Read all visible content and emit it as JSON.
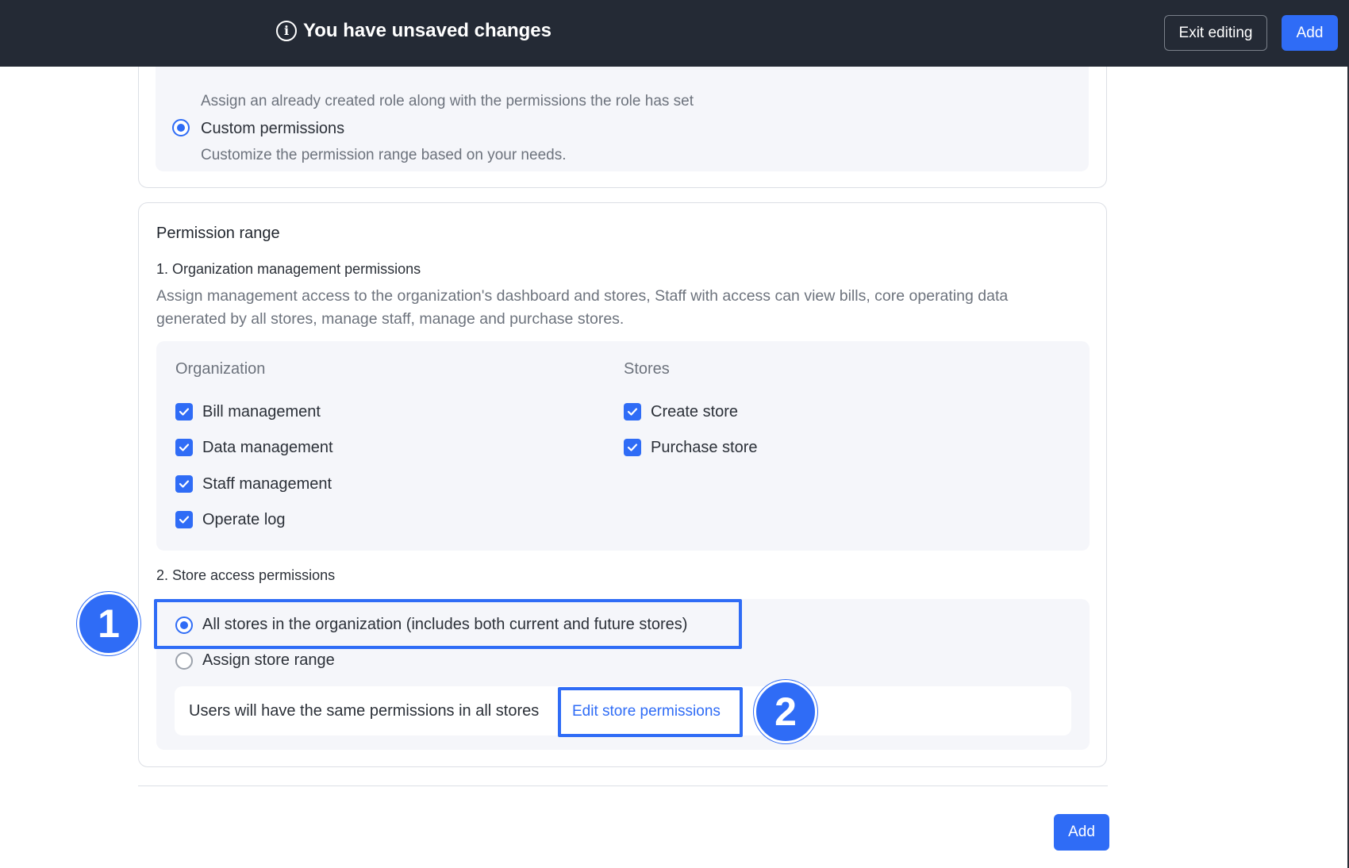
{
  "topbar": {
    "notice": "You have unsaved changes",
    "info_icon": "info-icon",
    "exit_label": "Exit editing",
    "add_label": "Add"
  },
  "role_card": {
    "existing_role_desc": "Assign an already created role along with the permissions the role has set",
    "custom_label": "Custom permissions",
    "custom_desc": "Customize the permission range based on your needs.",
    "custom_selected": true
  },
  "permission_range": {
    "title": "Permission range",
    "org_section": {
      "heading": "1. Organization management permissions",
      "desc_line1": "Assign management access to the organization's dashboard and stores, Staff with access can view bills, core operating data",
      "desc_line2": "generated by all stores, manage staff, manage and purchase stores.",
      "organization_header": "Organization",
      "stores_header": "Stores",
      "organization_items": [
        {
          "label": "Bill management",
          "checked": true
        },
        {
          "label": "Data management",
          "checked": true
        },
        {
          "label": "Staff management",
          "checked": true
        },
        {
          "label": "Operate log",
          "checked": true
        }
      ],
      "store_items": [
        {
          "label": "Create store",
          "checked": true
        },
        {
          "label": "Purchase store",
          "checked": true
        }
      ]
    },
    "store_section": {
      "heading": "2. Store access permissions",
      "all_stores_label": "All stores in the organization (includes both current and future stores)",
      "all_stores_selected": true,
      "assign_range_label": "Assign store range",
      "note": "Users will have the same permissions in all stores",
      "edit_link": "Edit store permissions"
    }
  },
  "annotations": {
    "badge_1": "1",
    "badge_2": "2",
    "highlight_color": "#2f6cf6"
  },
  "footer": {
    "add_label": "Add"
  },
  "colors": {
    "accent": "#2f6cf6",
    "topbar_bg": "#242a35",
    "panel_bg": "#f5f6fa"
  }
}
